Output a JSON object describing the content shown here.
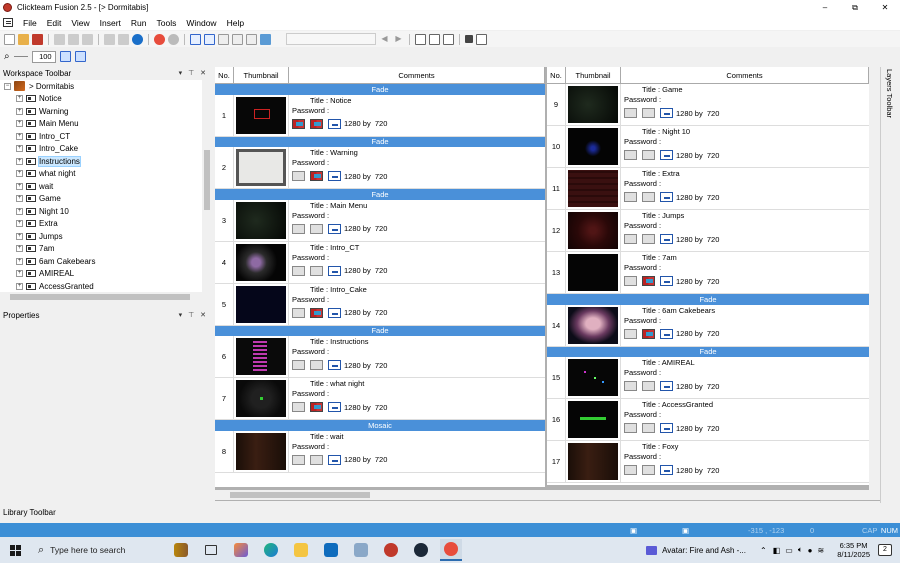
{
  "window": {
    "title": "Clickteam Fusion 2.5 - [> Dormitabis]",
    "controls": [
      "–",
      "⧉",
      "✕"
    ]
  },
  "menu": [
    "File",
    "Edit",
    "View",
    "Insert",
    "Run",
    "Tools",
    "Window",
    "Help"
  ],
  "zoom": "100",
  "workspace": {
    "title": "Workspace Toolbar",
    "root": "> Dormitabis",
    "items": [
      "Notice",
      "Warning",
      "Main Menu",
      "Intro_CT",
      "Intro_Cake",
      "Instructions",
      "what night",
      "wait",
      "Game",
      "Night 10",
      "Extra",
      "Jumps",
      "7am",
      "6am Cakebears",
      "AMIREAL",
      "AccessGranted"
    ],
    "selected": "Instructions"
  },
  "properties_title": "Properties",
  "library_title": "Library Toolbar",
  "layers_title": "Layers Toolbar",
  "columns": {
    "no": "No.",
    "thumb": "Thumbnail",
    "comments": "Comments"
  },
  "labels": {
    "title_prefix": "Title : ",
    "password": "Password :",
    "by": "by"
  },
  "left_column": [
    {
      "band": "Fade"
    },
    {
      "no": "1",
      "title": "Notice",
      "w": "1280",
      "h": "720",
      "transin": true,
      "transout": true,
      "thumb": "red"
    },
    {
      "band": "Fade"
    },
    {
      "no": "2",
      "title": "Warning",
      "w": "1280",
      "h": "720",
      "transin": false,
      "transout": true,
      "thumb": "white"
    },
    {
      "band": "Fade"
    },
    {
      "no": "3",
      "title": "Main Menu",
      "w": "1280",
      "h": "720",
      "transin": false,
      "transout": false,
      "thumb": "darkgreen"
    },
    {
      "no": "4",
      "title": "Intro_CT",
      "w": "1280",
      "h": "720",
      "transin": false,
      "transout": false,
      "thumb": "face"
    },
    {
      "no": "5",
      "title": "Intro_Cake",
      "w": "1280",
      "h": "720",
      "transin": false,
      "transout": true,
      "thumb": "navy"
    },
    {
      "band": "Fade"
    },
    {
      "no": "6",
      "title": "Instructions",
      "w": "1280",
      "h": "720",
      "transin": false,
      "transout": false,
      "thumb": "pink"
    },
    {
      "no": "7",
      "title": "what night",
      "w": "1280",
      "h": "720",
      "transin": false,
      "transout": true,
      "thumb": "dot"
    },
    {
      "band": "Mosaic"
    },
    {
      "no": "8",
      "title": "wait",
      "w": "1280",
      "h": "720",
      "transin": false,
      "transout": false,
      "thumb": "room"
    }
  ],
  "right_column": [
    {
      "no": "9",
      "title": "Game",
      "w": "1280",
      "h": "720",
      "transin": false,
      "transout": false,
      "thumb": "darkgreen"
    },
    {
      "no": "10",
      "title": "Night 10",
      "w": "1280",
      "h": "720",
      "transin": false,
      "transout": false,
      "thumb": "blue"
    },
    {
      "no": "11",
      "title": "Extra",
      "w": "1280",
      "h": "720",
      "transin": false,
      "transout": false,
      "thumb": "grid"
    },
    {
      "no": "12",
      "title": "Jumps",
      "w": "1280",
      "h": "720",
      "transin": false,
      "transout": false,
      "thumb": "redglow"
    },
    {
      "no": "13",
      "title": "7am",
      "w": "1280",
      "h": "720",
      "transin": false,
      "transout": true,
      "thumb": "black"
    },
    {
      "band": "Fade"
    },
    {
      "no": "14",
      "title": "6am Cakebears",
      "w": "1280",
      "h": "720",
      "transin": false,
      "transout": true,
      "thumb": "bear"
    },
    {
      "band": "Fade"
    },
    {
      "no": "15",
      "title": "AMIREAL",
      "w": "1280",
      "h": "720",
      "transin": false,
      "transout": false,
      "thumb": "dots"
    },
    {
      "no": "16",
      "title": "AccessGranted",
      "w": "1280",
      "h": "720",
      "transin": false,
      "transout": false,
      "thumb": "greentext"
    },
    {
      "no": "17",
      "title": "Foxy",
      "w": "1280",
      "h": "720",
      "transin": false,
      "transout": false,
      "thumb": "room"
    }
  ],
  "statusbar": {
    "coords": "-315 , -123",
    "zero": "0",
    "caps": "CAP",
    "num": "NUM"
  },
  "taskbar": {
    "search_placeholder": "Type here to search",
    "media": "Avatar: Fire and Ash -...",
    "time": "6:35 PM",
    "date": "8/11/2025",
    "notifications": "2"
  }
}
